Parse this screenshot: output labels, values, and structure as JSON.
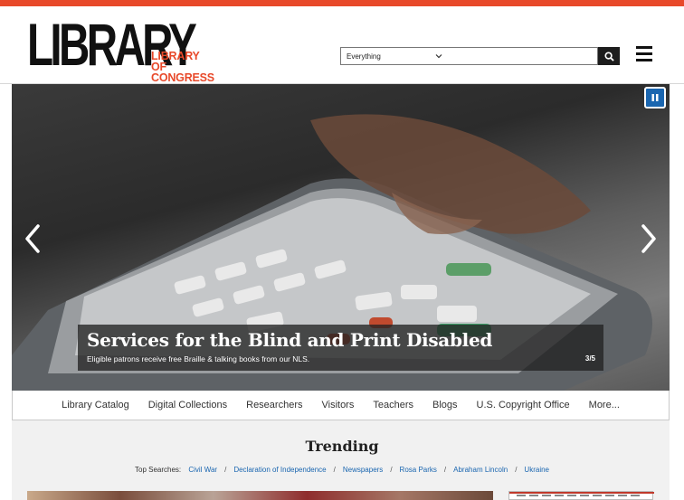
{
  "header": {
    "logo_main": "LIBRARY",
    "logo_sub_line1": "LIBRARY",
    "logo_sub_line2": "OF CONGRESS",
    "accent_color": "#e8492a"
  },
  "search": {
    "scope_selected": "Everything",
    "query_value": "",
    "search_icon": "search-icon"
  },
  "menu_icon": "hamburger-menu-icon",
  "hero": {
    "title": "Services for the Blind and Print Disabled",
    "subtitle": "Eligible patrons receive free Braille & talking books from our NLS.",
    "counter": "3/5",
    "pause_icon": "pause-icon",
    "prev_icon": "chevron-left-icon",
    "next_icon": "chevron-right-icon"
  },
  "nav": {
    "items": [
      "Library Catalog",
      "Digital Collections",
      "Researchers",
      "Visitors",
      "Teachers",
      "Blogs",
      "U.S. Copyright Office",
      "More..."
    ]
  },
  "trending": {
    "title": "Trending",
    "top_searches_label": "Top Searches:",
    "links": [
      "Civil War",
      "Declaration of Independence",
      "Newspapers",
      "Rosa Parks",
      "Abraham Lincoln",
      "Ukraine"
    ],
    "separator": "/"
  }
}
